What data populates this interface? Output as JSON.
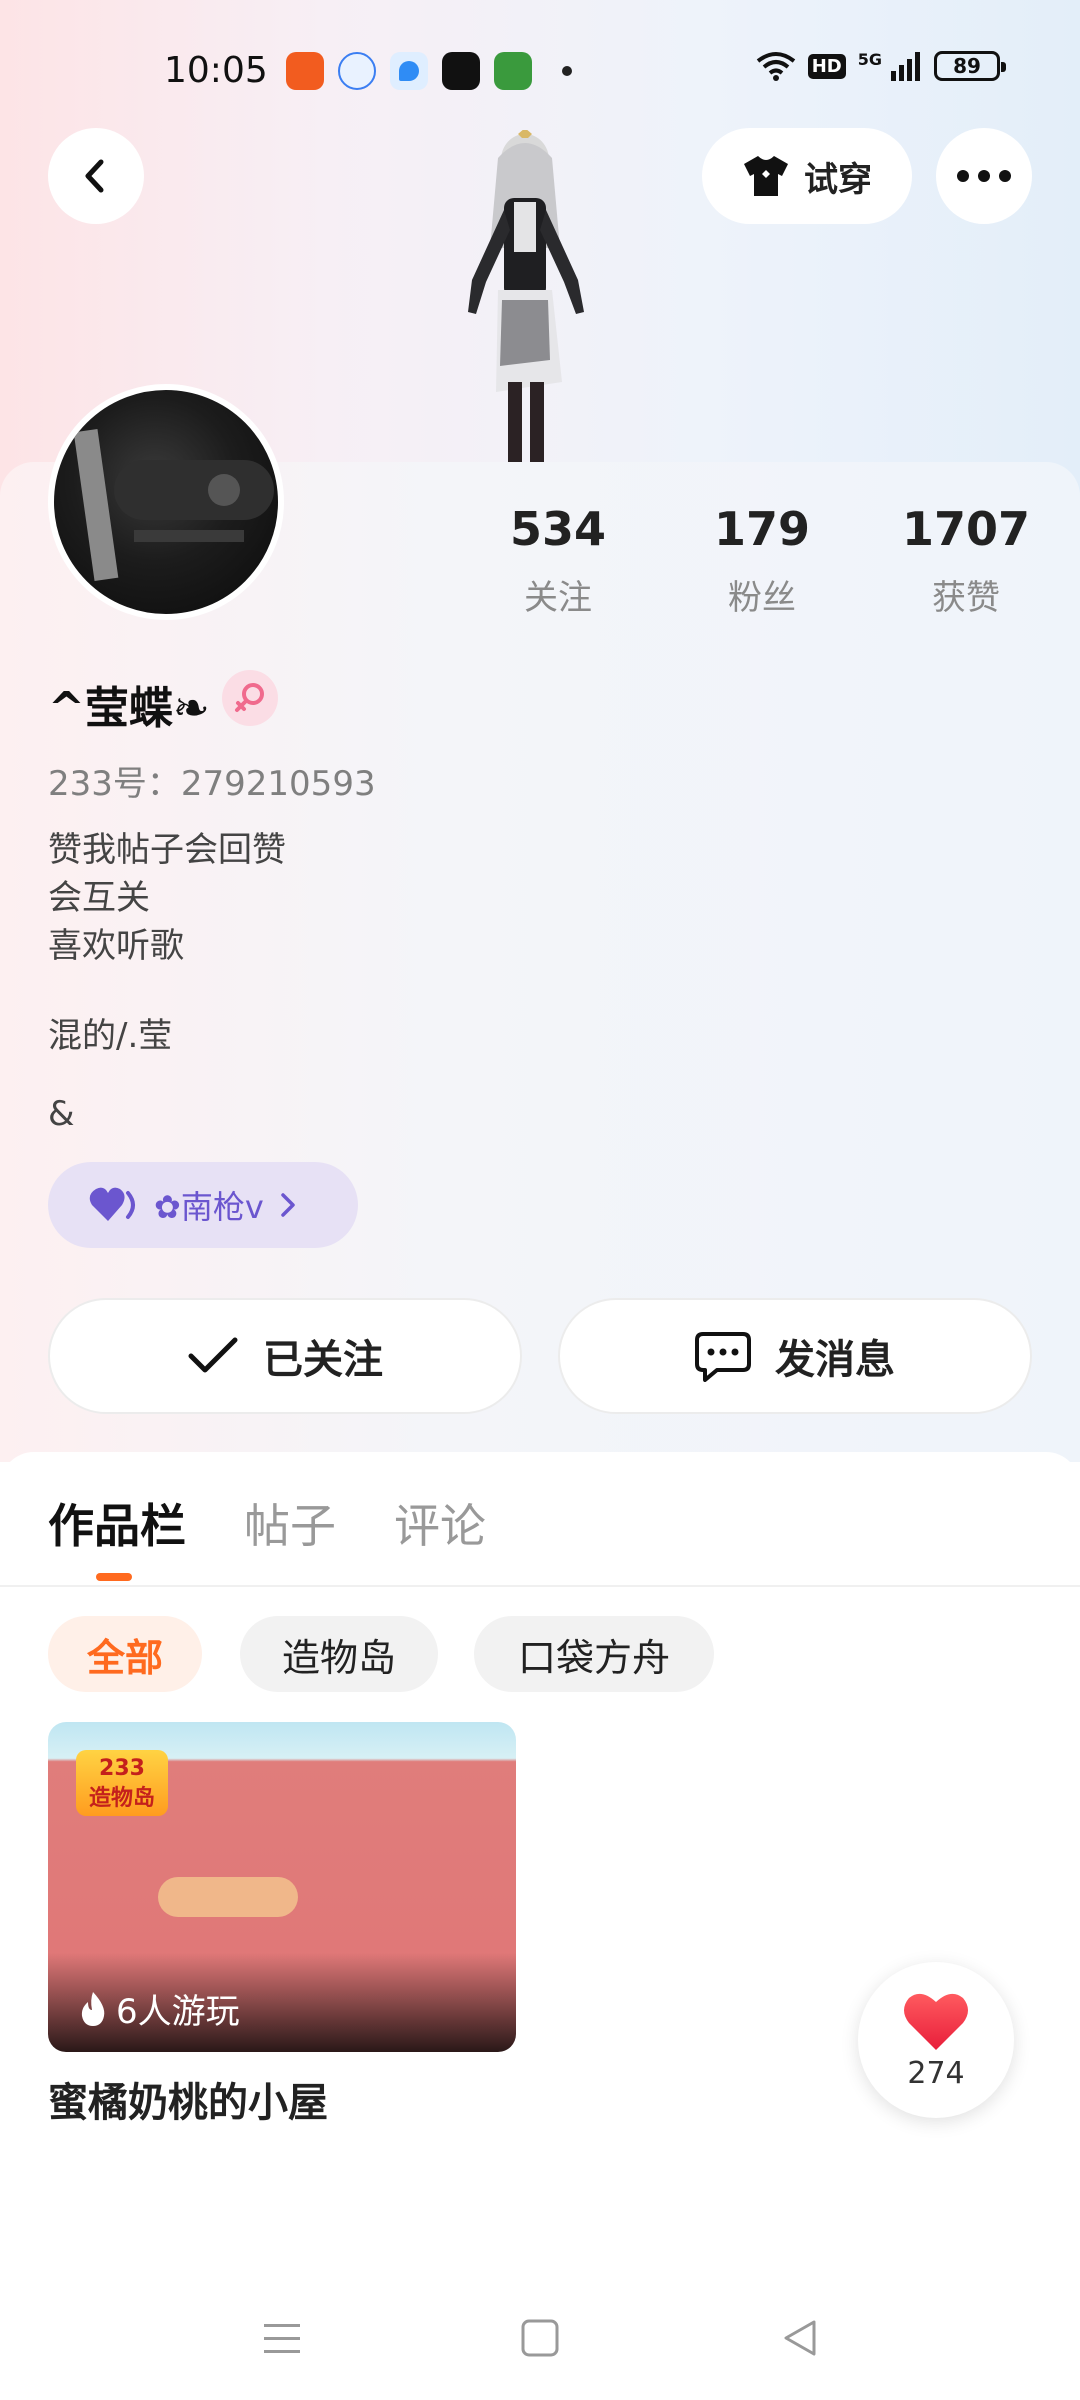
{
  "status_bar": {
    "time": "10:05",
    "network": "5G",
    "hd": "HD",
    "battery": "89"
  },
  "top_bar": {
    "try_on_label": "试穿"
  },
  "profile": {
    "stats": [
      {
        "value": "534",
        "label": "关注"
      },
      {
        "value": "179",
        "label": "粉丝"
      },
      {
        "value": "1707",
        "label": "获赞"
      }
    ],
    "username": "^莹蝶❧",
    "account_id": "233号：279210593",
    "bio": [
      "赞我帖子会回赞",
      "会互关",
      "喜欢听歌",
      "混的/.莹",
      "&"
    ],
    "tag_label": "✿南枪v",
    "follow_label": "已关注",
    "message_label": "发消息"
  },
  "tabs": [
    {
      "label": "作品栏",
      "active": true
    },
    {
      "label": "帖子",
      "active": false
    },
    {
      "label": "评论",
      "active": false
    }
  ],
  "filters": [
    {
      "label": "全部",
      "active": true
    },
    {
      "label": "造物岛",
      "active": false
    },
    {
      "label": "口袋方舟",
      "active": false
    }
  ],
  "works": [
    {
      "badge_top": "233",
      "badge_bottom": "造物岛",
      "plays": "6人游玩",
      "title": "蜜橘奶桃的小屋"
    }
  ],
  "like_fab": {
    "count": "274"
  },
  "colors": {
    "accent": "#ff6a1f",
    "tag_bg": "#e7e1f5",
    "tag_text": "#6b56cf",
    "like_red": "#f23b45"
  }
}
